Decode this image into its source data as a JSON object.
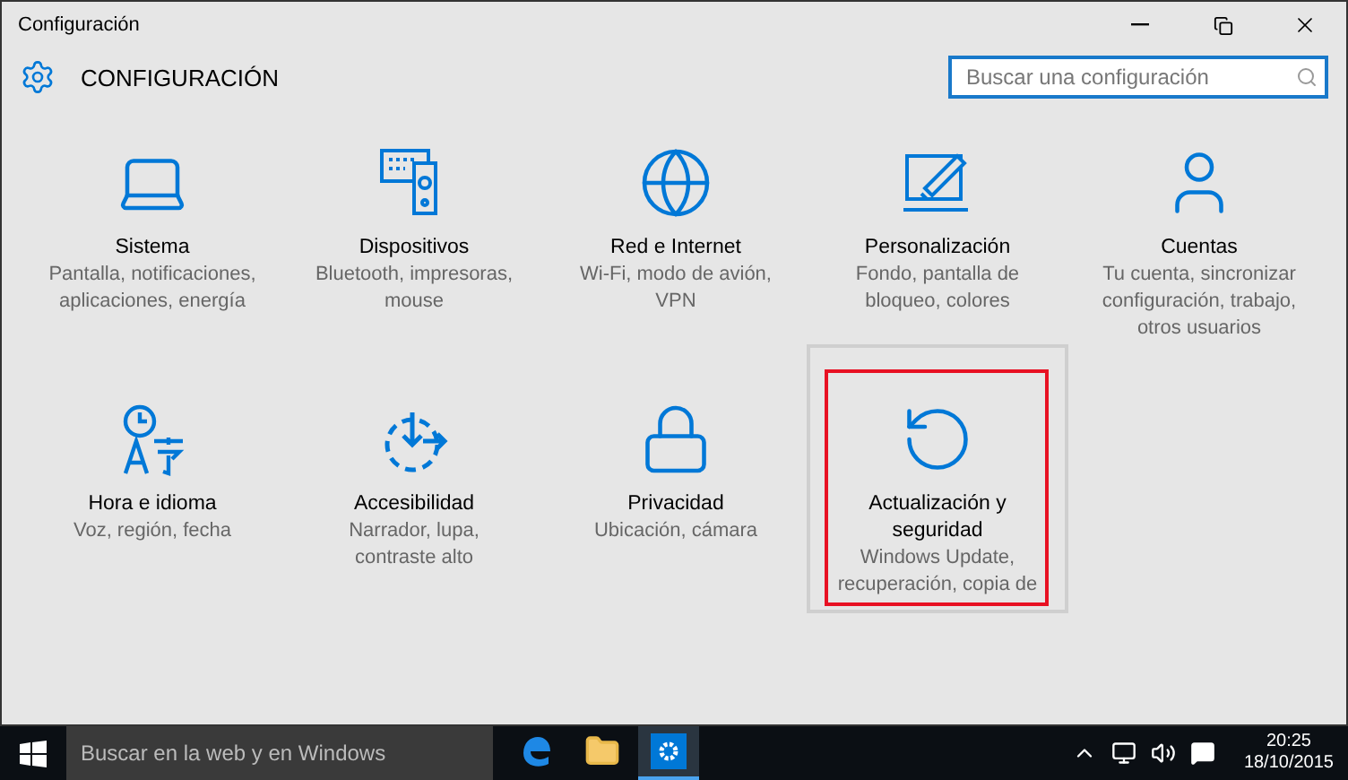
{
  "window": {
    "title": "Configuración"
  },
  "header": {
    "title": "CONFIGURACIÓN"
  },
  "search": {
    "placeholder": "Buscar una configuración"
  },
  "tiles": [
    {
      "kind": "laptop",
      "title": [
        "Sistema"
      ],
      "description": [
        "Pantalla, notificaciones,",
        "aplicaciones, energía"
      ],
      "selected": false
    },
    {
      "kind": "devices",
      "title": [
        "Dispositivos"
      ],
      "description": [
        "Bluetooth, impresoras,",
        "mouse"
      ],
      "selected": false
    },
    {
      "kind": "globe",
      "title": [
        "Red e Internet"
      ],
      "description": [
        "Wi-Fi, modo de avión,",
        "VPN"
      ],
      "selected": false
    },
    {
      "kind": "paint",
      "title": [
        "Personalización"
      ],
      "description": [
        "Fondo, pantalla de",
        "bloqueo, colores"
      ],
      "selected": false
    },
    {
      "kind": "person",
      "title": [
        "Cuentas"
      ],
      "description": [
        "Tu cuenta, sincronizar",
        "configuración, trabajo,",
        "otros usuarios"
      ],
      "selected": false
    },
    {
      "kind": "language",
      "title": [
        "Hora e idioma"
      ],
      "description": [
        "Voz, región, fecha"
      ],
      "selected": false
    },
    {
      "kind": "access",
      "title": [
        "Accesibilidad"
      ],
      "description": [
        "Narrador, lupa,",
        "contraste alto"
      ],
      "selected": false
    },
    {
      "kind": "lock",
      "title": [
        "Privacidad"
      ],
      "description": [
        "Ubicación, cámara"
      ],
      "selected": false
    },
    {
      "kind": "update",
      "title": [
        "Actualización y",
        "seguridad"
      ],
      "description": [
        "Windows Update,",
        "recuperación, copia de"
      ],
      "selected": true
    }
  ],
  "taskbar": {
    "search_placeholder": "Buscar en la web y en Windows",
    "apps": [
      {
        "kind": "edge",
        "selected": false
      },
      {
        "kind": "folder",
        "selected": false
      },
      {
        "kind": "settings",
        "selected": true
      }
    ],
    "time": "20:25",
    "date": "18/10/2015"
  }
}
